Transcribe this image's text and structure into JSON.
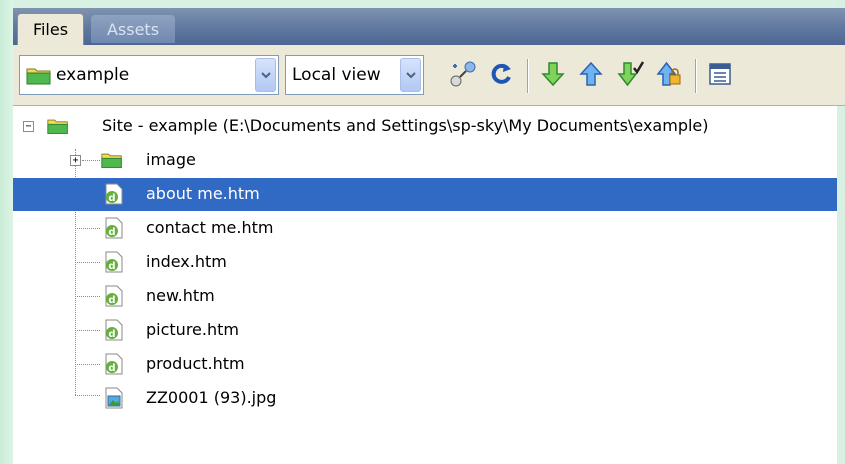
{
  "tabs": [
    {
      "label": "Files",
      "active": true
    },
    {
      "label": "Assets",
      "active": false
    }
  ],
  "toolbar": {
    "site_select": {
      "value": "example",
      "icon": "folder-icon"
    },
    "view_select": {
      "value": "Local view"
    },
    "buttons": [
      {
        "name": "connect-button",
        "icon": "connect-icon"
      },
      {
        "name": "refresh-button",
        "icon": "refresh-icon"
      },
      {
        "name": "get-files-button",
        "icon": "get-arrow-icon"
      },
      {
        "name": "put-files-button",
        "icon": "put-arrow-icon"
      },
      {
        "name": "check-out-button",
        "icon": "check-out-icon"
      },
      {
        "name": "check-in-button",
        "icon": "check-in-icon"
      },
      {
        "name": "expand-panel-button",
        "icon": "expand-icon"
      }
    ]
  },
  "tree": {
    "root": {
      "label": "Site - example (E:\\Documents and Settings\\sp-sky\\My Documents\\example)",
      "icon": "folder-icon",
      "expanded": true
    },
    "items": [
      {
        "label": "image",
        "icon": "folder-icon",
        "type": "folder",
        "expanded": false
      },
      {
        "label": "about me.htm",
        "icon": "html-file-icon",
        "type": "file",
        "selected": true
      },
      {
        "label": "contact me.htm",
        "icon": "html-file-icon",
        "type": "file"
      },
      {
        "label": "index.htm",
        "icon": "html-file-icon",
        "type": "file"
      },
      {
        "label": "new.htm",
        "icon": "html-file-icon",
        "type": "file"
      },
      {
        "label": "picture.htm",
        "icon": "html-file-icon",
        "type": "file"
      },
      {
        "label": "product.htm",
        "icon": "html-file-icon",
        "type": "file"
      },
      {
        "label": "ZZ0001 (93).jpg",
        "icon": "image-file-icon",
        "type": "file"
      }
    ]
  },
  "colors": {
    "selection": "#316ac5",
    "toolbar_bg": "#ece9d8",
    "tabbar_bg": "#5f78a0"
  }
}
